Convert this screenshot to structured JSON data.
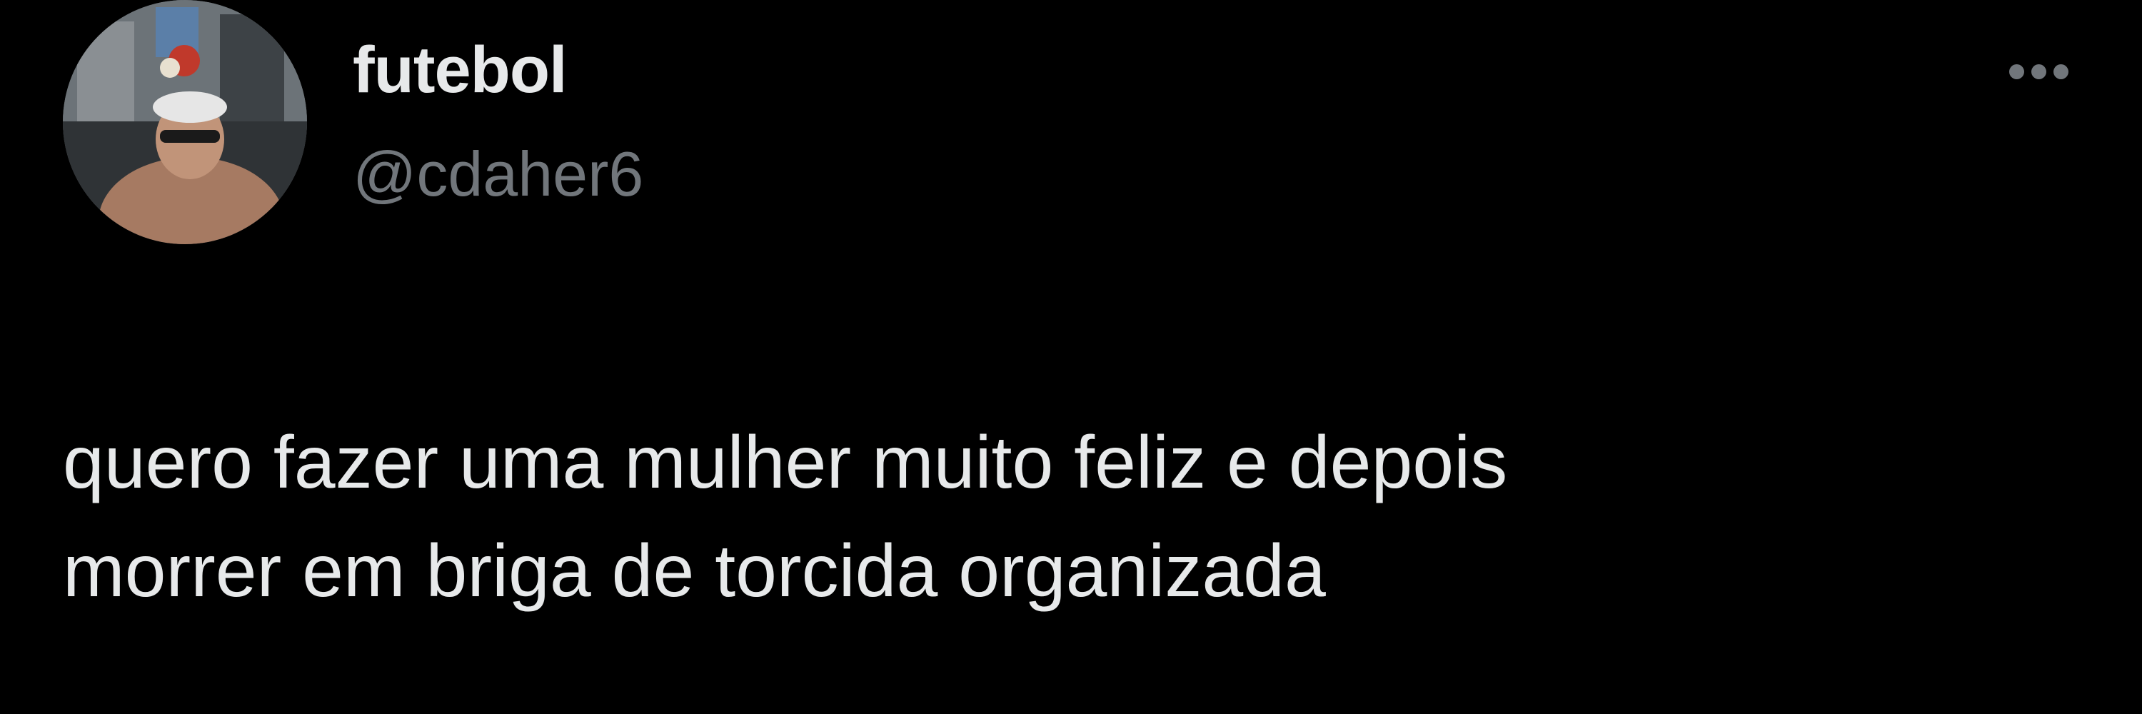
{
  "tweet": {
    "author": {
      "display_name": "futebol",
      "handle": "@cdaher6",
      "avatar": "profile-photo"
    },
    "more_icon": "more-horizontal-icon",
    "text": "quero fazer uma mulher muito feliz e depois\nmorrer em briga de torcida organizada"
  },
  "colors": {
    "background": "#000000",
    "primary_text": "#e7e9ea",
    "secondary_text": "#71767b"
  }
}
